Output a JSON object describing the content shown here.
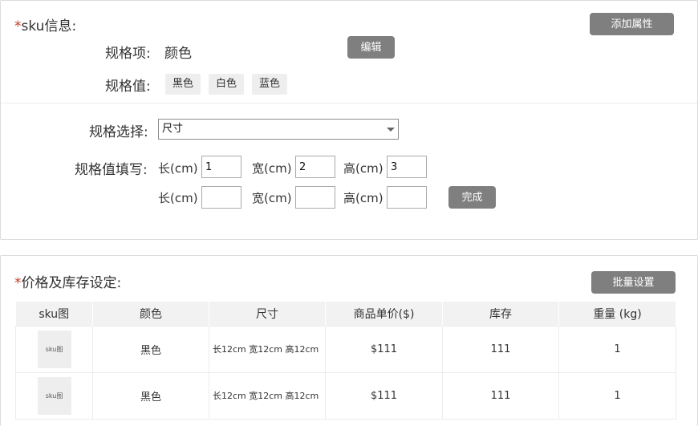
{
  "sku_section": {
    "required_mark": "*",
    "title": "sku信息:",
    "add_attr_button": "添加属性",
    "spec_item_label": "规格项:",
    "spec_item_value": "颜色",
    "edit_button": "编辑",
    "spec_value_label": "规格值:",
    "spec_values": [
      "黑色",
      "白色",
      "蓝色"
    ],
    "spec_select_label": "规格选择:",
    "spec_select_value": "尺寸",
    "fill_label": "规格值填写:",
    "row1": {
      "len_label": "长(cm)",
      "len_value": "1",
      "wid_label": "宽(cm)",
      "wid_value": "2",
      "hei_label": "高(cm)",
      "hei_value": "3"
    },
    "row2": {
      "len_label": "长(cm)",
      "len_value": "",
      "wid_label": "宽(cm)",
      "wid_value": "",
      "hei_label": "高(cm)",
      "hei_value": ""
    },
    "done_button": "完成"
  },
  "price_section": {
    "required_mark": "*",
    "title": "价格及库存设定:",
    "batch_button": "批量设置",
    "columns": [
      "sku图",
      "颜色",
      "尺寸",
      "商品单价($)",
      "库存",
      "重量 (kg)"
    ],
    "rows": [
      {
        "image_label": "sku图",
        "color": "黑色",
        "size": "长12cm 宽12cm 高12cm",
        "price": "$111",
        "stock": "111",
        "weight": "1"
      },
      {
        "image_label": "sku图",
        "color": "黑色",
        "size": "长12cm 宽12cm 高12cm",
        "price": "$111",
        "stock": "111",
        "weight": "1"
      }
    ]
  }
}
